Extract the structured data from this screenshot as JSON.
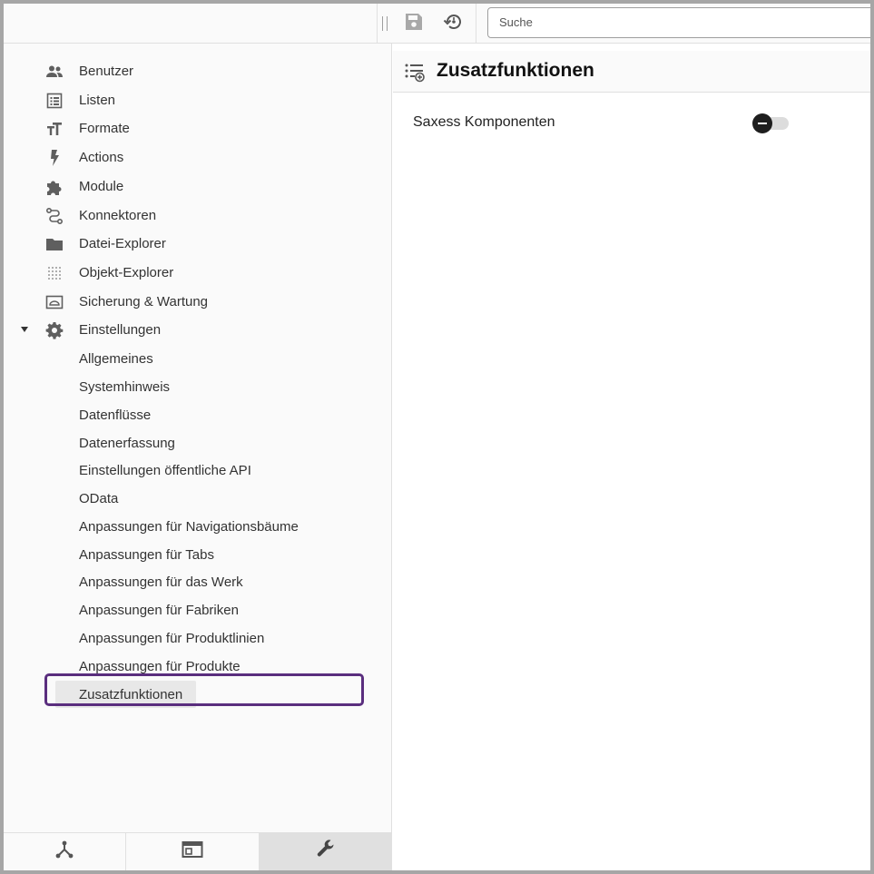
{
  "toolbar": {
    "search_placeholder": "Suche",
    "save_icon": "save-icon",
    "history_icon": "history-icon"
  },
  "sidebar": {
    "items": [
      {
        "label": "Benutzer",
        "icon": "users-icon"
      },
      {
        "label": "Listen",
        "icon": "list-icon"
      },
      {
        "label": "Formate",
        "icon": "text-format-icon"
      },
      {
        "label": "Actions",
        "icon": "bolt-icon"
      },
      {
        "label": "Module",
        "icon": "puzzle-icon"
      },
      {
        "label": "Konnektoren",
        "icon": "route-icon"
      },
      {
        "label": "Datei-Explorer",
        "icon": "folder-icon"
      },
      {
        "label": "Objekt-Explorer",
        "icon": "dot-grid-icon"
      },
      {
        "label": "Sicherung & Wartung",
        "icon": "backup-icon"
      },
      {
        "label": "Einstellungen",
        "icon": "gear-icon"
      }
    ],
    "sub_items": [
      "Allgemeines",
      "Systemhinweis",
      "Datenflüsse",
      "Datenerfassung",
      "Einstellungen öffentliche API",
      "OData",
      "Anpassungen für Navigationsbäume",
      "Anpassungen für Tabs",
      "Anpassungen für das Werk",
      "Anpassungen für Fabriken",
      "Anpassungen für Produktlinien",
      "Anpassungen für Produkte",
      "Zusatzfunktionen"
    ],
    "selected": "Zusatzfunktionen",
    "bottom_tabs": [
      "hierarchy-icon",
      "window-icon",
      "wrench-icon"
    ],
    "active_bottom_tab": "wrench-icon"
  },
  "main": {
    "title": "Zusatzfunktionen",
    "settings": [
      {
        "label": "Saxess Komponenten",
        "enabled": false
      }
    ]
  },
  "colors": {
    "highlight_border": "#5a2e7e",
    "toggle_knob": "#1e1e1e"
  }
}
